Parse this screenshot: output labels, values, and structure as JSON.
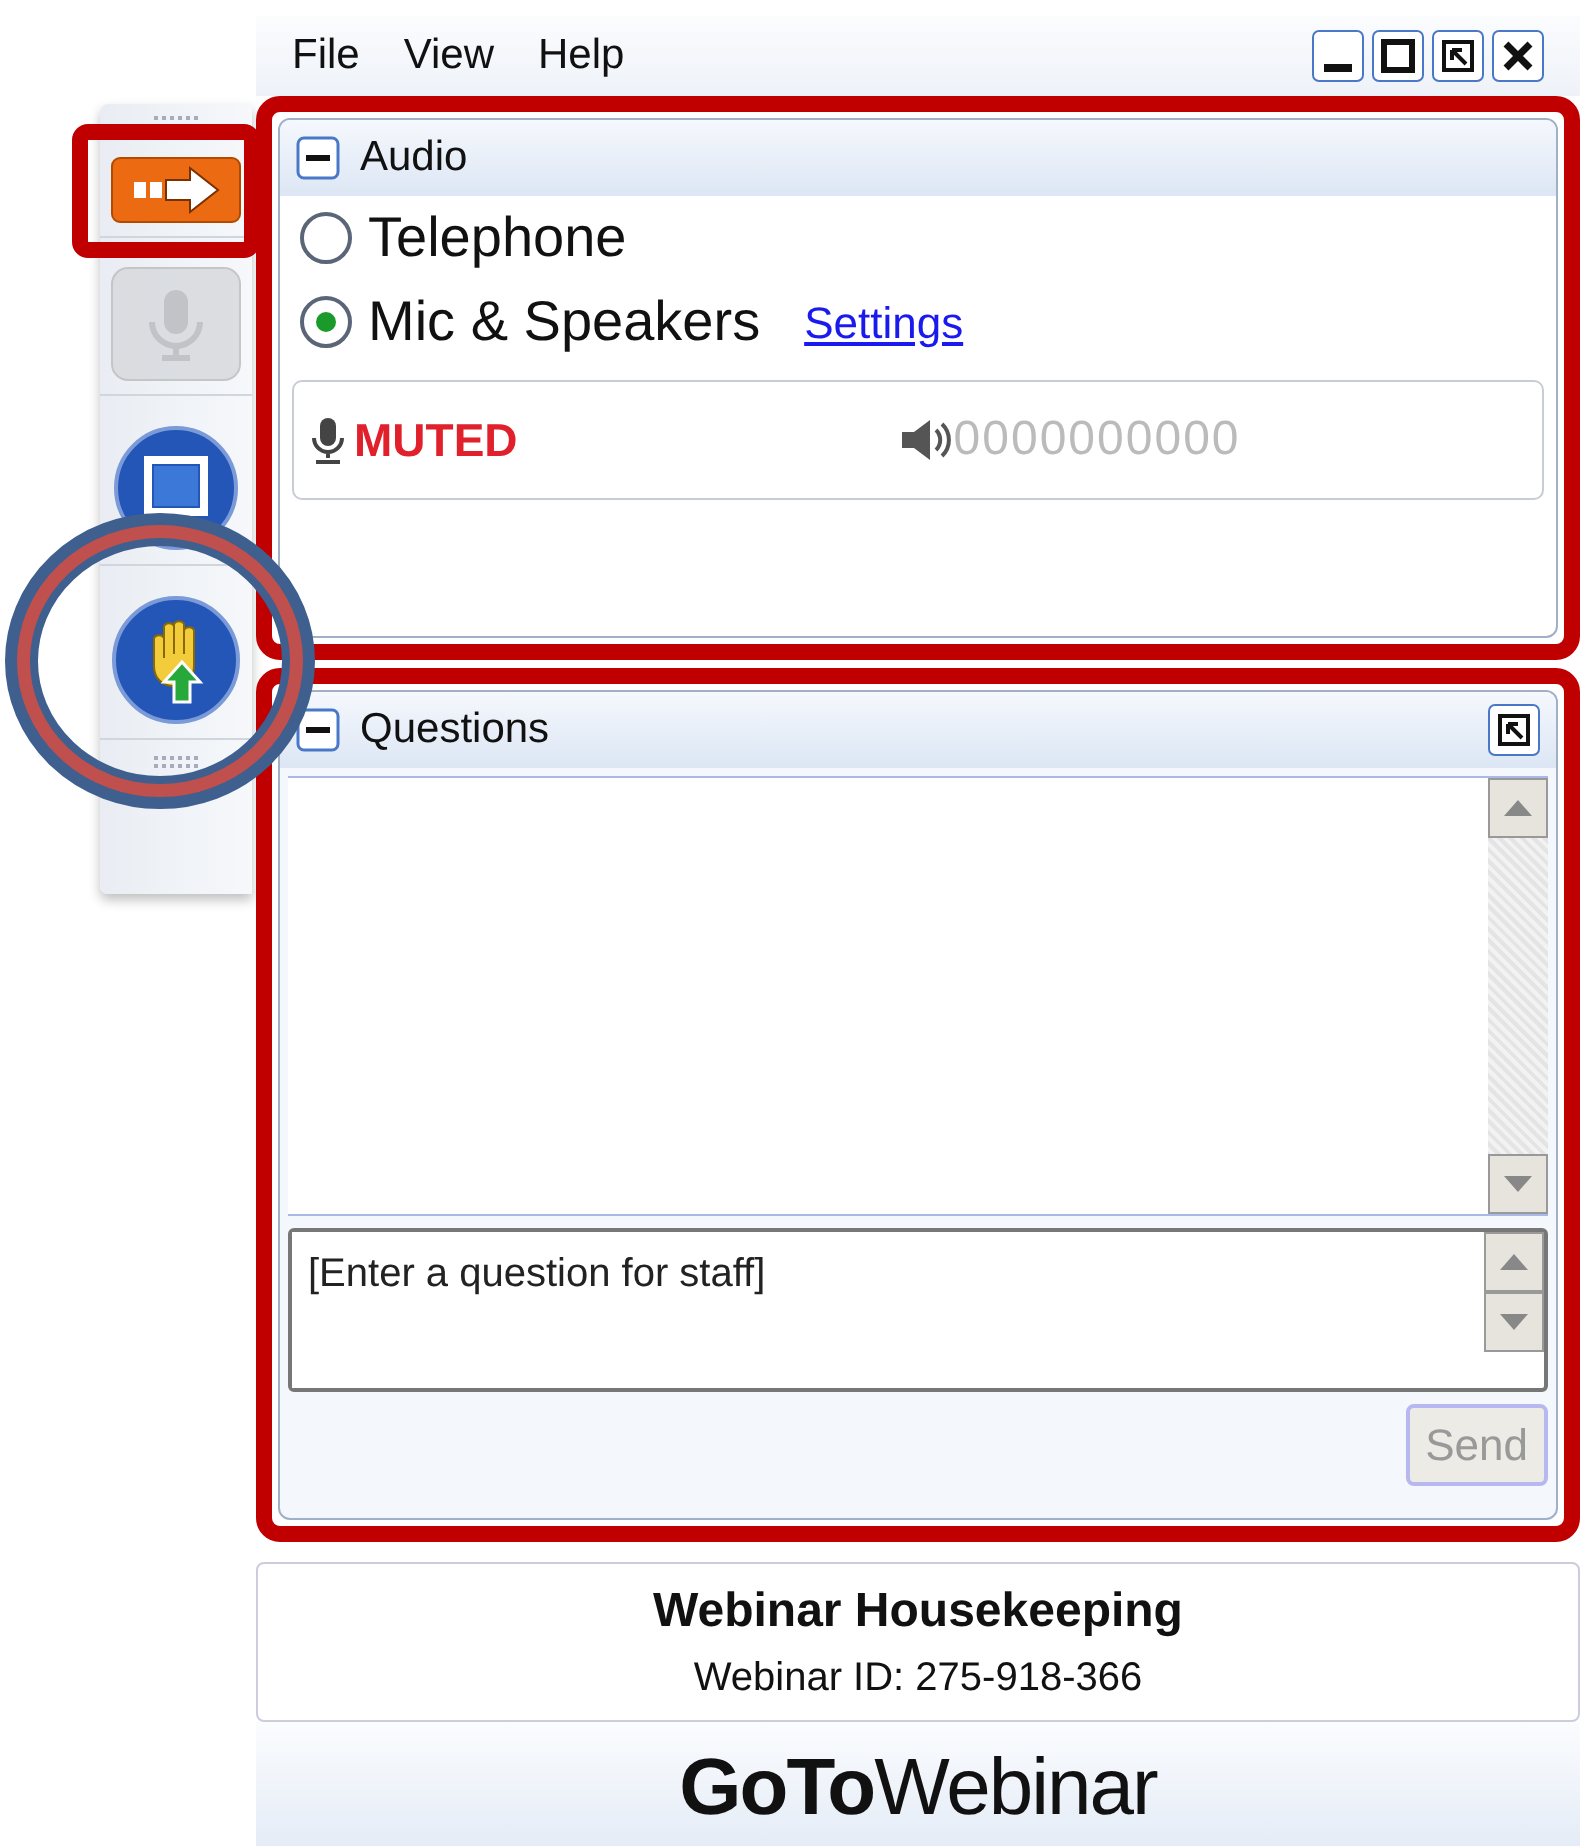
{
  "menu": [
    "File",
    "View",
    "Help"
  ],
  "window_controls": [
    {
      "kind": "minimize"
    },
    {
      "kind": "maximize"
    },
    {
      "kind": "popout"
    },
    {
      "kind": "close"
    }
  ],
  "toolbar": [
    {
      "kind": "arrow",
      "disabled": false,
      "highlighted": true
    },
    {
      "kind": "mic",
      "disabled": true,
      "highlighted": false
    },
    {
      "kind": "screen",
      "disabled": false,
      "highlighted": false
    },
    {
      "kind": "hand",
      "disabled": false,
      "highlighted": true
    }
  ],
  "audio": {
    "title": "Audio",
    "expanded": true,
    "highlighted": true,
    "options": [
      {
        "label": "Telephone",
        "selected": false
      },
      {
        "label": "Mic & Speakers",
        "selected": true
      }
    ],
    "settings_link": "Settings",
    "mic_status": "MUTED",
    "speaker_level": "0000000000"
  },
  "questions": {
    "title": "Questions",
    "expanded": true,
    "highlighted": true,
    "placeholder": "[Enter a question for staff]",
    "send": {
      "label": "Send",
      "disabled": true
    }
  },
  "footer": {
    "title": "Webinar Housekeeping",
    "webinar_id": "Webinar ID: 275-918-366",
    "logo": "**GoTo**Webinar"
  }
}
